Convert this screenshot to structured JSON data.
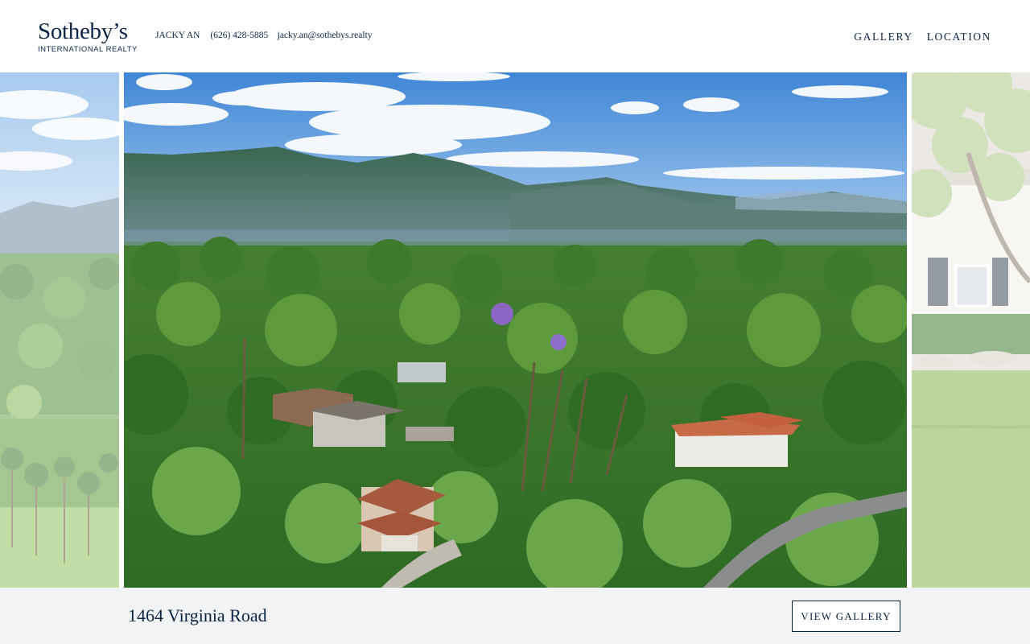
{
  "brand": {
    "logo_name": "Sotheby’s",
    "logo_sub": "INTERNATIONAL REALTY",
    "color": "#0b2546"
  },
  "contact": {
    "agent": "JACKY AN",
    "phone": "(626) 428-5885",
    "email": "jacky.an@sothebys.realty"
  },
  "nav": {
    "items": [
      {
        "label": "GALLERY"
      },
      {
        "label": "LOCATION"
      }
    ]
  },
  "gallery": {
    "slides": [
      {
        "position": "previous",
        "scene": "aerial-palm-field"
      },
      {
        "position": "current",
        "scene": "aerial-mountains-neighborhood"
      },
      {
        "position": "next",
        "scene": "house-front-lawn"
      }
    ]
  },
  "listing": {
    "address": "1464 Virginia Road",
    "view_gallery_label": "VIEW GALLERY"
  }
}
